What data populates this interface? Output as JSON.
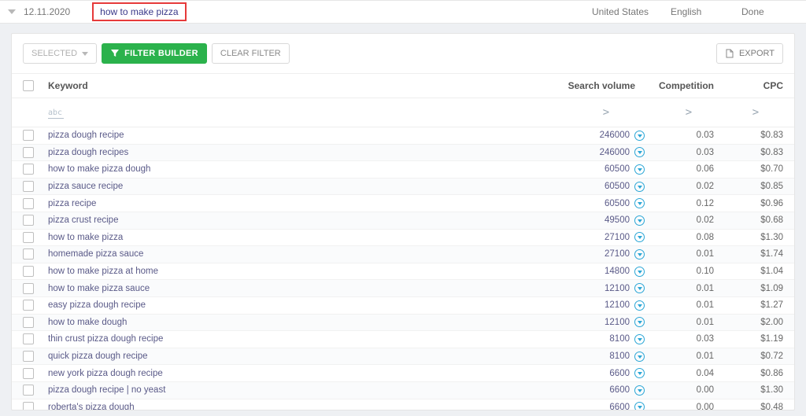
{
  "top": {
    "date": "12.11.2020",
    "query": "how to make pizza",
    "country": "United States",
    "language": "English",
    "status": "Done"
  },
  "toolbar": {
    "selected_label": "SELECTED",
    "filter_label": "FILTER BUILDER",
    "clear_label": "CLEAR FILTER",
    "export_label": "EXPORT"
  },
  "columns": {
    "keyword": "Keyword",
    "search_volume": "Search volume",
    "competition": "Competition",
    "cpc": "CPC"
  },
  "filter_row": {
    "keyword_hint": "abc",
    "gt": ">"
  },
  "rows": [
    {
      "keyword": "pizza dough recipe",
      "volume": "246000",
      "competition": "0.03",
      "cpc": "$0.83"
    },
    {
      "keyword": "pizza dough recipes",
      "volume": "246000",
      "competition": "0.03",
      "cpc": "$0.83"
    },
    {
      "keyword": "how to make pizza dough",
      "volume": "60500",
      "competition": "0.06",
      "cpc": "$0.70"
    },
    {
      "keyword": "pizza sauce recipe",
      "volume": "60500",
      "competition": "0.02",
      "cpc": "$0.85"
    },
    {
      "keyword": "pizza recipe",
      "volume": "60500",
      "competition": "0.12",
      "cpc": "$0.96"
    },
    {
      "keyword": "pizza crust recipe",
      "volume": "49500",
      "competition": "0.02",
      "cpc": "$0.68"
    },
    {
      "keyword": "how to make pizza",
      "volume": "27100",
      "competition": "0.08",
      "cpc": "$1.30"
    },
    {
      "keyword": "homemade pizza sauce",
      "volume": "27100",
      "competition": "0.01",
      "cpc": "$1.74"
    },
    {
      "keyword": "how to make pizza at home",
      "volume": "14800",
      "competition": "0.10",
      "cpc": "$1.04"
    },
    {
      "keyword": "how to make pizza sauce",
      "volume": "12100",
      "competition": "0.01",
      "cpc": "$1.09"
    },
    {
      "keyword": "easy pizza dough recipe",
      "volume": "12100",
      "competition": "0.01",
      "cpc": "$1.27"
    },
    {
      "keyword": "how to make dough",
      "volume": "12100",
      "competition": "0.01",
      "cpc": "$2.00"
    },
    {
      "keyword": "thin crust pizza dough recipe",
      "volume": "8100",
      "competition": "0.03",
      "cpc": "$1.19"
    },
    {
      "keyword": "quick pizza dough recipe",
      "volume": "8100",
      "competition": "0.01",
      "cpc": "$0.72"
    },
    {
      "keyword": "new york pizza dough recipe",
      "volume": "6600",
      "competition": "0.04",
      "cpc": "$0.86"
    },
    {
      "keyword": "pizza dough recipe | no yeast",
      "volume": "6600",
      "competition": "0.00",
      "cpc": "$1.30"
    },
    {
      "keyword": "roberta's pizza dough",
      "volume": "6600",
      "competition": "0.00",
      "cpc": "$0.48"
    }
  ]
}
